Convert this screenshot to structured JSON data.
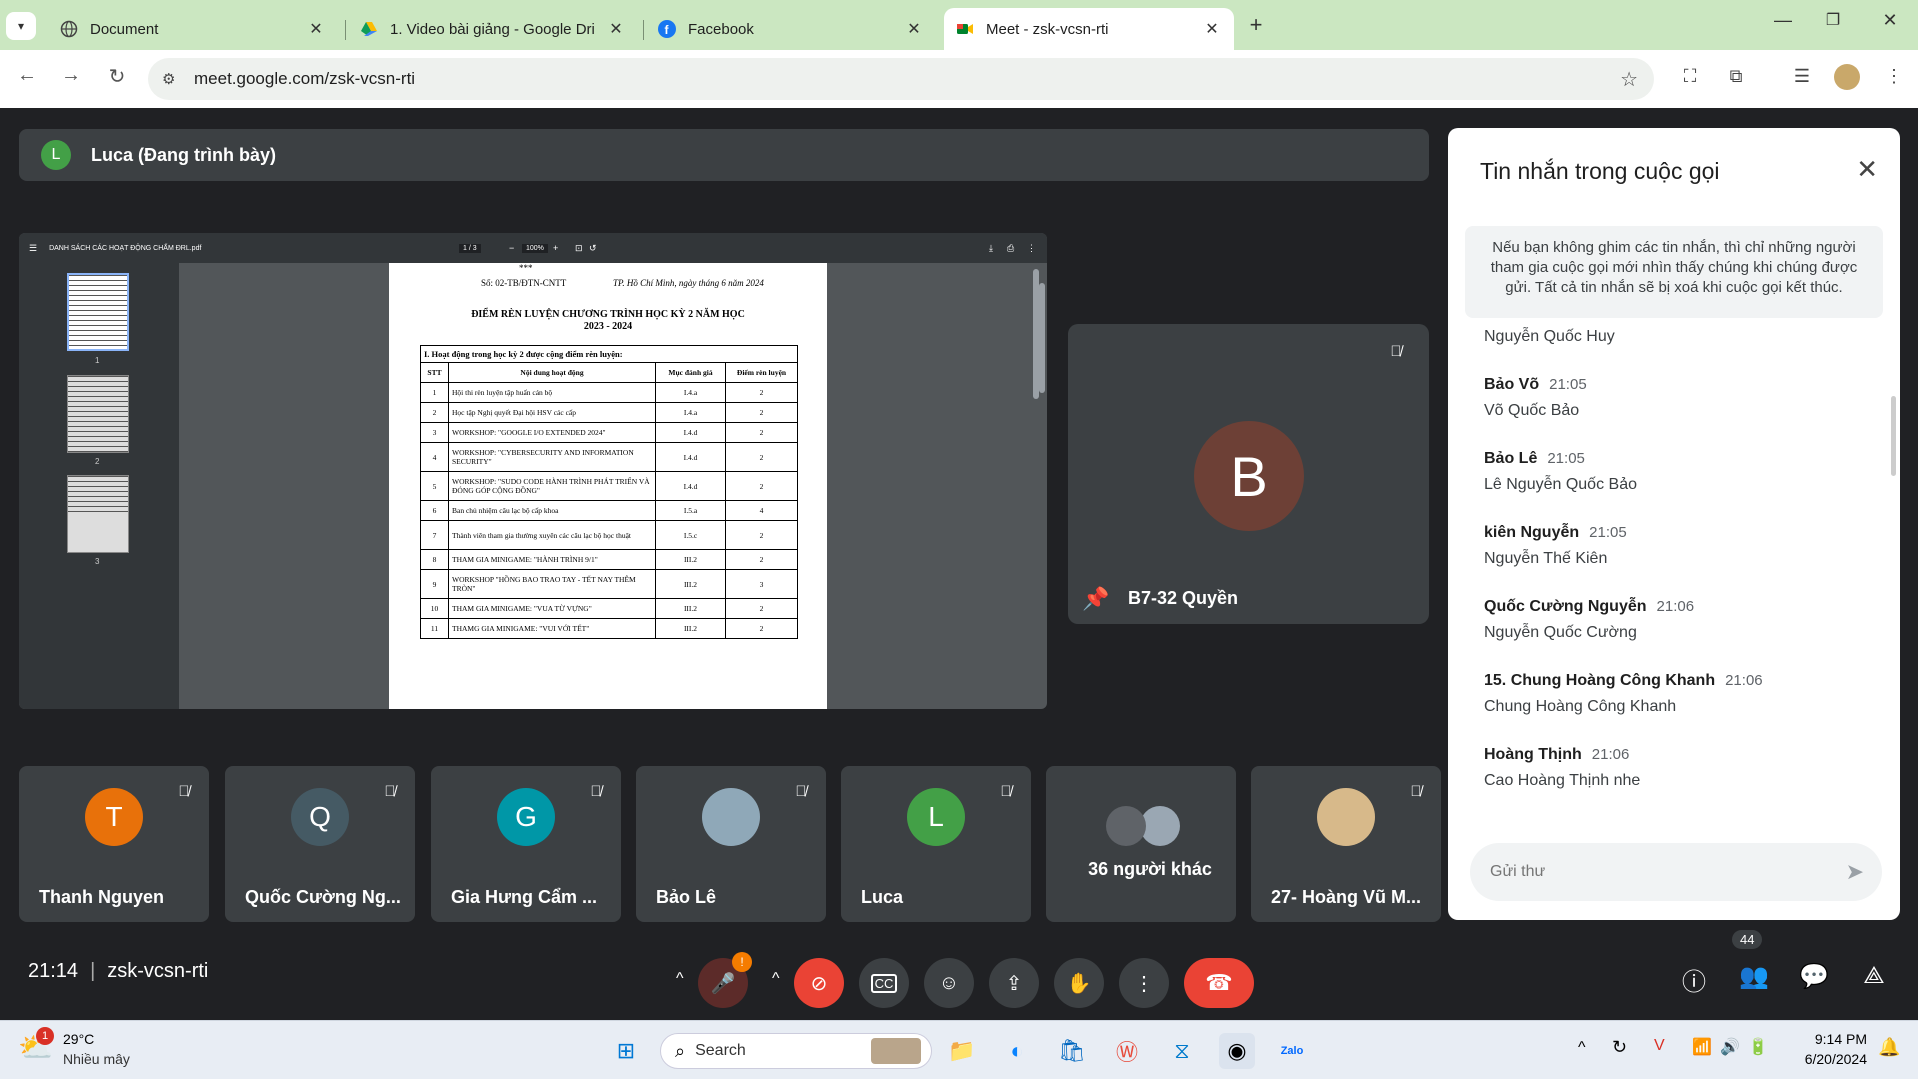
{
  "browser": {
    "tabs": [
      {
        "label": "Document",
        "icon": "globe-icon"
      },
      {
        "label": "1. Video bài giảng - Google Dri",
        "icon": "google-drive-icon"
      },
      {
        "label": "Facebook",
        "icon": "facebook-icon"
      },
      {
        "label": "Meet - zsk-vcsn-rti",
        "icon": "google-meet-icon",
        "active": true
      }
    ],
    "new_tab": "+",
    "url": "meet.google.com/zsk-vcsn-rti"
  },
  "presenter": {
    "initial": "L",
    "label": "Luca (Đang trình bày)"
  },
  "pdf": {
    "filename": "DANH SÁCH CÁC HOẠT ĐỘNG CHẤM ĐRL.pdf",
    "page_indicator": "1 / 3",
    "zoom": "100%",
    "thumb_pages": [
      "1",
      "2",
      "3"
    ],
    "stars": "***",
    "doc_number": "Số: 02-TB/ĐTN-CNTT",
    "place_date": "TP. Hồ Chí Minh, ngày      tháng 6 năm 2024",
    "title": "ĐIỂM RÈN LUYỆN CHƯƠNG TRÌNH HỌC KỲ 2 NĂM HỌC",
    "year": "2023 - 2024",
    "section": "I. Hoạt động trong học kỳ 2 được cộng điểm rèn luyện:",
    "headers": [
      "STT",
      "Nội dung hoạt động",
      "Mục đánh giá",
      "Điểm rèn luyện"
    ],
    "rows": [
      [
        "1",
        "Hội thi rèn luyện tập huấn cán bộ",
        "I.4.a",
        "2"
      ],
      [
        "2",
        "Học tập Nghị quyết Đại hội HSV các cấp",
        "I.4.a",
        "2"
      ],
      [
        "3",
        "WORKSHOP: \"GOOGLE I/O EXTENDED 2024\"",
        "I.4.d",
        "2"
      ],
      [
        "4",
        "WORKSHOP: \"CYBERSECURITY AND INFORMATION SECURITY\"",
        "I.4.d",
        "2"
      ],
      [
        "5",
        "WORKSHOP: \"SUDO CODE HÀNH TRÌNH PHÁT TRIỂN VÀ ĐÓNG GÓP CỘNG ĐỒNG\"",
        "I.4.d",
        "2"
      ],
      [
        "6",
        "Ban chủ nhiệm câu lạc bộ cấp khoa",
        "I.5.a",
        "4"
      ],
      [
        "7",
        "Thành viên tham gia thường xuyên các câu lạc bộ học thuật",
        "I.5.c",
        "2"
      ],
      [
        "8",
        "THAM GIA MINIGAME: \"HÀNH TRÌNH 9/1\"",
        "III.2",
        "2"
      ],
      [
        "9",
        "WORKSHOP \"HỒNG BAO TRAO TAY - TẾT NAY THÊM TRÒN\"",
        "III.2",
        "3"
      ],
      [
        "10",
        "THAM GIA MINIGAME: \"VUA TỪ VỰNG\"",
        "III.2",
        "2"
      ],
      [
        "11",
        "THAMG GIA MINIGAME: \"VUI VỚI TẾT\"",
        "III.2",
        "2"
      ]
    ]
  },
  "pinned_tile": {
    "initial": "B",
    "name": "B7-32 Quyền"
  },
  "participants": [
    {
      "initial": "T",
      "name": "Thanh Nguyen",
      "color": "#e8710a"
    },
    {
      "initial": "Q",
      "name": "Quốc Cường Ng...",
      "color": "#455a64"
    },
    {
      "initial": "G",
      "name": "Gia Hưng Cẩm ...",
      "color": "#0097a7"
    },
    {
      "initial": "",
      "name": "Bảo Lê",
      "color": "#8fa8b8"
    },
    {
      "initial": "L",
      "name": "Luca",
      "color": "#43a047"
    },
    {
      "initial": "",
      "name": "36 người khác",
      "color": "#5f6368"
    },
    {
      "initial": "",
      "name": "27- Hoàng Vũ M...",
      "color": "#d7b98a"
    }
  ],
  "chat": {
    "title": "Tin nhắn trong cuộc gọi",
    "notice": "Nếu bạn không ghim các tin nhắn, thì chỉ những người tham gia cuộc gọi mới nhìn thấy chúng khi chúng được gửi. Tất cả tin nhắn sẽ bị xoá khi cuộc gọi kết thúc.",
    "messages": [
      {
        "sender": "",
        "time": "",
        "text": "Nguyễn Quốc Huy"
      },
      {
        "sender": "Bảo Võ",
        "time": "21:05",
        "text": "Võ Quốc Bảo"
      },
      {
        "sender": "Bảo Lê",
        "time": "21:05",
        "text": "Lê Nguyễn Quốc Bảo"
      },
      {
        "sender": "kiên Nguyễn",
        "time": "21:05",
        "text": "Nguyễn Thế Kiên"
      },
      {
        "sender": "Quốc Cường Nguyễn",
        "time": "21:06",
        "text": "Nguyễn Quốc Cường"
      },
      {
        "sender": "15. Chung Hoàng Công Khanh",
        "time": "21:06",
        "text": "Chung Hoàng Công Khanh"
      },
      {
        "sender": "Hoàng Thịnh",
        "time": "21:06",
        "text": "Cao Hoàng Thịnh nhe"
      }
    ],
    "input_placeholder": "Gửi thư"
  },
  "meeting": {
    "time": "21:14",
    "separator": "|",
    "code": "zsk-vcsn-rti",
    "people_count": "44",
    "mic_warning": "!"
  },
  "taskbar": {
    "weather_badge": "1",
    "temperature": "29°C",
    "weather": "Nhiều mây",
    "search": "Search",
    "time": "9:14 PM",
    "date": "6/20/2024"
  },
  "colors": {
    "tabbar": "#cbe7c1",
    "meet_bg": "#202124",
    "tile": "#3c4043",
    "end_call": "#ea4335",
    "mic_off": "#ea4335"
  }
}
